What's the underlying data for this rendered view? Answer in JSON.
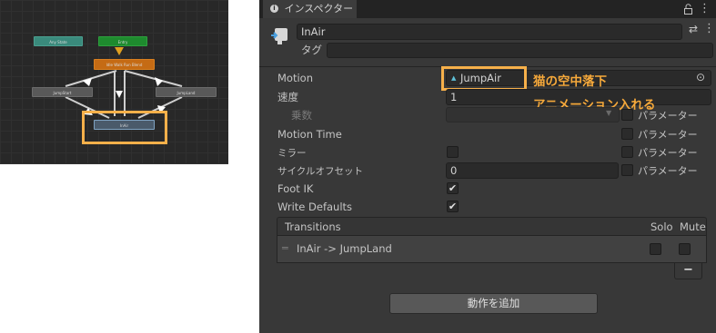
{
  "animator": {
    "nodes": {
      "any_state": "Any State",
      "entry": "Entry",
      "idle": "Idle Walk Run Blend",
      "jump_start": "JumpStart",
      "jump_land": "JumpLand",
      "in_air": "InAir"
    }
  },
  "inspector": {
    "tab_title": "インスペクター",
    "object_name": "InAir",
    "tag_label": "タグ",
    "rows": {
      "motion_label": "Motion",
      "motion_value": "JumpAir",
      "speed_label": "速度",
      "speed_value": "1",
      "multiplier_label": "乗数",
      "motion_time_label": "Motion Time",
      "mirror_label": "ミラー",
      "cycle_offset_label": "サイクルオフセット",
      "cycle_offset_value": "0",
      "foot_ik_label": "Foot IK",
      "write_defaults_label": "Write Defaults"
    },
    "parameter_label": "パラメーター",
    "transitions": {
      "header": "Transitions",
      "solo": "Solo",
      "mute": "Mute",
      "item": "InAir -> JumpLand",
      "remove_label": "−"
    },
    "add_behaviour": "動作を追加"
  },
  "annotations": {
    "line1": "猫の空中落下",
    "line2": "アニメーション入れる",
    "highlight_color": "#f6b04a"
  }
}
